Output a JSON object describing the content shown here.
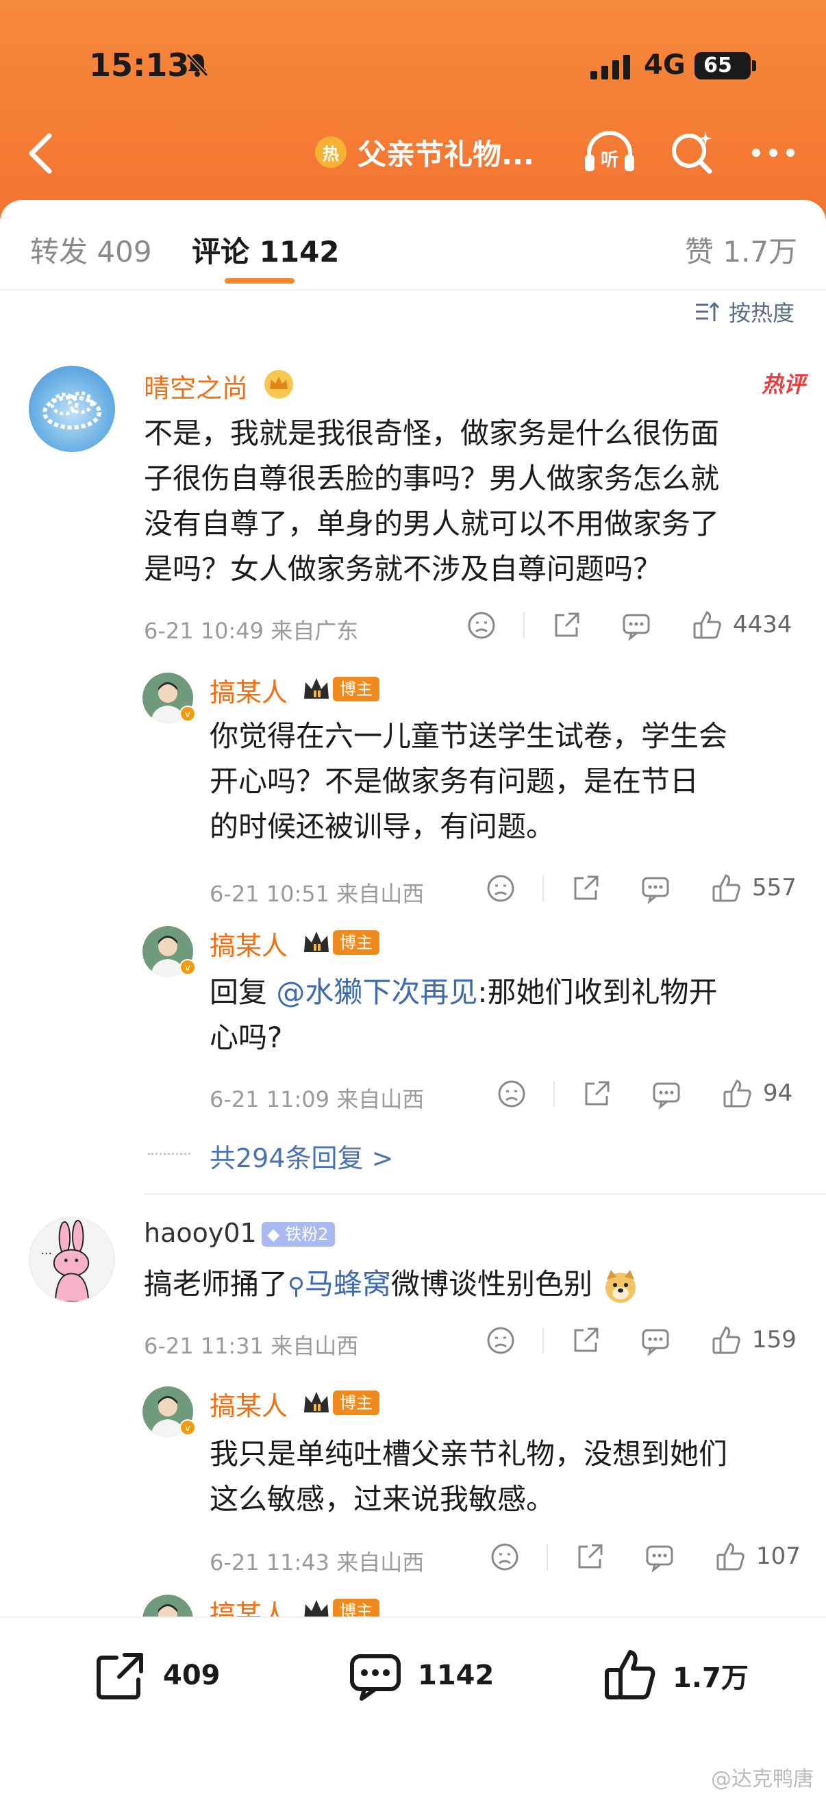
{
  "status_bar": {
    "time": "15:13",
    "network": "4G",
    "battery": "65"
  },
  "header": {
    "title": "父亲节礼物...",
    "hot_badge": "热"
  },
  "tabs": {
    "repost_label": "转发",
    "repost_count": "409",
    "comment_label": "评论",
    "comment_count": "1142",
    "like_label": "赞",
    "like_count": "1.7万"
  },
  "sort_label": "按热度",
  "comments": [
    {
      "user": "晴空之尚",
      "tag": "热评",
      "text_lines": [
        "不是，我就是我很奇怪，做家务是什么很伤面",
        "子很伤自尊很丢脸的事吗？男人做家务怎么就",
        "没有自尊了，单身的男人就可以不用做家务了",
        "是吗？女人做家务就不涉及自尊问题吗？"
      ],
      "meta": "6-21 10:49  来自广东",
      "likes": "4434",
      "replies": [
        {
          "user": "搞某人",
          "badge": "博主",
          "text_lines": [
            "你觉得在六一儿童节送学生试卷，学生会",
            "开心吗？不是做家务有问题，是在节日",
            "的时候还被训导，有问题。"
          ],
          "meta": "6-21 10:51  来自山西",
          "likes": "557"
        },
        {
          "user": "搞某人",
          "badge": "博主",
          "reply_prefix": "回复 ",
          "mention": "@水獭下次再见",
          "text_rest": ":那她们收到礼物开",
          "text_line2": "心吗?",
          "meta": "6-21 11:09  来自山西",
          "likes": "94"
        }
      ],
      "more_replies": "共294条回复 >"
    },
    {
      "user": "haooy01",
      "fan_badge": "铁粉2",
      "text_before": "搞老师捅了",
      "search_link": "马蜂窝",
      "text_after": "微博谈性别色别",
      "meta": "6-21 11:31  来自山西",
      "likes": "159",
      "replies": [
        {
          "user": "搞某人",
          "badge": "博主",
          "text_lines": [
            "我只是单纯吐槽父亲节礼物，没想到她们",
            "这么敏感，过来说我敏感。"
          ],
          "meta": "6-21 11:43  来自山西",
          "likes": "107"
        },
        {
          "user": "搞某人",
          "badge": "博主"
        }
      ]
    }
  ],
  "bottom_bar": {
    "repost": "409",
    "comment": "1142",
    "like": "1.7万"
  },
  "watermark": "@达克鸭唐",
  "colors": {
    "header_orange": "#f47c35",
    "accent": "#f5872f",
    "username": "#f06f12",
    "link": "#3d6ab0"
  }
}
